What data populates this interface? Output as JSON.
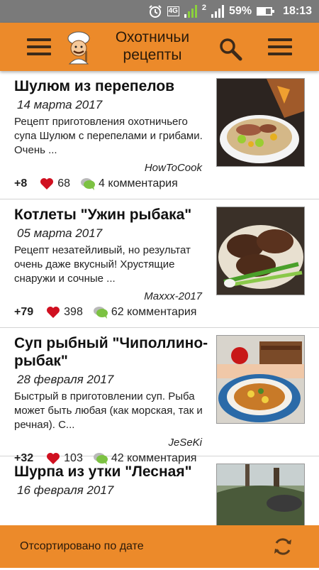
{
  "status": {
    "lte_label": "4G",
    "sim_label": "2",
    "battery": "59%",
    "time": "18:13"
  },
  "header": {
    "title": "Охотничьи рецепты"
  },
  "recipes": [
    {
      "title": "Шулюм из перепелов",
      "date": "14 марта 2017",
      "description": "Рецепт приготовления охотничьего супа Шулюм с перепелами и грибами. Очень ...",
      "author": "HowToCook",
      "score": "+8",
      "likes": "68",
      "comments": "4 комментария"
    },
    {
      "title": "Котлеты \"Ужин рыбака\"",
      "date": "05 марта 2017",
      "description": "Рецепт незатейливый, но результат очень даже вкусный! Хрустящие снаружи и сочные ...",
      "author": "Maxxx-2017",
      "score": "+79",
      "likes": "398",
      "comments": "62 комментария"
    },
    {
      "title": "Суп рыбный \"Чиполлино-рыбак\"",
      "date": "28 февраля 2017",
      "description": "Быстрый в приготовлении суп. Рыба может быть любая (как морская, так и речная). С...",
      "author": "JeSeKi",
      "score": "+32",
      "likes": "103",
      "comments": "42 комментария"
    },
    {
      "title": "Шурпа из утки \"Лесная\"",
      "date": "16 февраля 2017"
    }
  ],
  "footer": {
    "sort_label": "Отсортировано по дате"
  },
  "colors": {
    "accent": "#ec8a2a",
    "status_bar": "#7a7a7a",
    "heart": "#d01020",
    "comment_bubble": "#7cc242"
  },
  "icons": [
    "menu-icon",
    "chef-logo-icon",
    "search-icon",
    "overflow-menu-icon",
    "heart-icon",
    "comment-icon",
    "refresh-icon"
  ]
}
